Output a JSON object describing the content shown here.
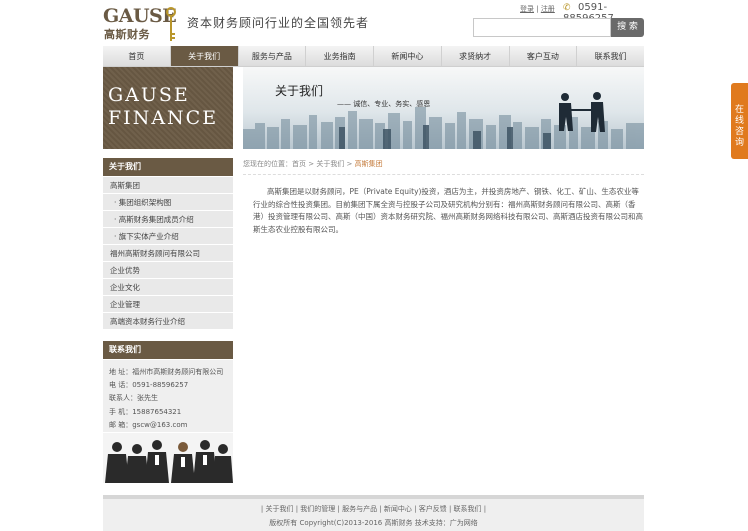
{
  "header": {
    "logo_text": "GAUSE",
    "logo_cn": "高斯财务",
    "slogan": "资本财务顾问行业的全国领先者",
    "login": "登录",
    "register": "注册",
    "phone": "0591-88596257",
    "search_placeholder": "",
    "search_button": "搜 索"
  },
  "nav": [
    "首页",
    "关于我们",
    "服务与产品",
    "业务指南",
    "新闻中心",
    "求贤纳才",
    "客户互动",
    "联系我们"
  ],
  "banner": {
    "brand_line1": "GAUSE",
    "brand_line2": "FINANCE",
    "title": "关于我们",
    "subtitle": "诚信、专业、务实、感恩"
  },
  "sidebar": {
    "about_title": "关于我们",
    "items": [
      "高斯集团",
      "集团组织架构图",
      "高斯财务集团成员介绍",
      "旗下实体产业介绍",
      "福州高斯财务顾问有限公司",
      "企业优势",
      "企业文化",
      "企业管理",
      "高端资本财务行业介绍"
    ],
    "contact_title": "联系我们",
    "contact": {
      "address": "地 址：福州市高斯财务顾问有限公司",
      "tel": "电 话：0591-88596257",
      "person": "联系人：张先生",
      "mobile": "手 机：15887654321",
      "email": "邮 箱：gscw@163.com"
    }
  },
  "breadcrumb": {
    "prefix": "您现在的位置：",
    "home": "首页",
    "sep1": " > ",
    "parent": "关于我们",
    "sep2": " > ",
    "current": "高斯集团"
  },
  "article": {
    "paragraph": "高斯集团是以财务顾问，PE（Private Equity)投资，酒店为主，并投资房地产、钢铁、化工、矿山、生态农业等行业的综合性投资集团。目前集团下属全资与控股子公司及研究机构分别有：福州高斯财务顾问有限公司、高斯（香港）投资管理有限公司、高斯（中国）资本财务研究院、福州高斯财务网络科技有限公司、高斯酒店投资有限公司和高斯生态农业控股有限公司。"
  },
  "float_tab": "在线咨询",
  "footer": {
    "links": [
      "关于我们",
      "我们的管理",
      "服务与产品",
      "新闻中心",
      "客户反馈",
      "联系我们"
    ],
    "copyright": "版权所有 Copyright(C)2013-2016 高斯财务",
    "support": "技术支持：广为网络"
  },
  "colors": {
    "brand_brown": "#6a5a44",
    "accent_orange": "#e07a1e",
    "breadcrumb_current": "#c47a3a"
  }
}
